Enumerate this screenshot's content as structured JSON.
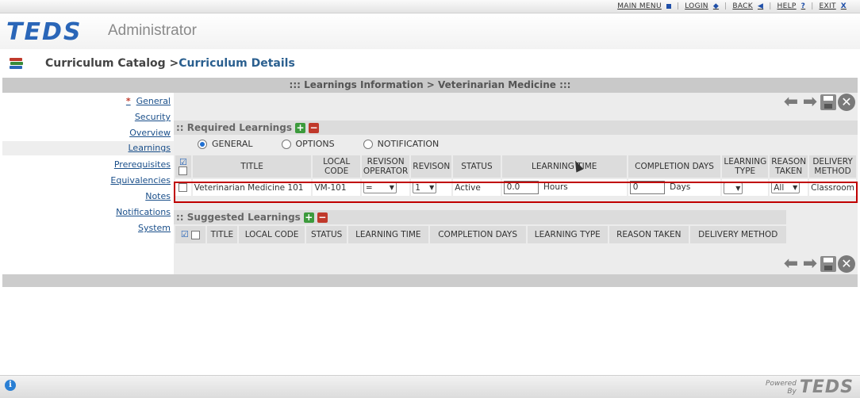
{
  "topnav": {
    "main_menu": "MAIN MENU",
    "login": "LOGIN",
    "back": "BACK",
    "help": "HELP",
    "exit": "EXIT",
    "sep": "|"
  },
  "header": {
    "logo": "TEDS",
    "subtitle": "Administrator"
  },
  "breadcrumb": {
    "parent": "Curriculum Catalog >",
    "current": "Curriculum Details"
  },
  "title_bar": "::: Learnings Information > Veterinarian Medicine :::",
  "sidebar": {
    "required_star": "*",
    "items": [
      {
        "label": "General"
      },
      {
        "label": "Security"
      },
      {
        "label": "Overview"
      },
      {
        "label": "Learnings"
      },
      {
        "label": "Prerequisites"
      },
      {
        "label": "Equivalencies"
      },
      {
        "label": "Notes"
      },
      {
        "label": "Notifications"
      },
      {
        "label": "System"
      }
    ]
  },
  "required": {
    "heading": ":: Required Learnings",
    "radio_options": [
      "GENERAL",
      "OPTIONS",
      "NOTIFICATION"
    ],
    "selected_radio": "GENERAL",
    "columns": [
      "TITLE",
      "LOCAL CODE",
      "REVISON OPERATOR",
      "REVISON",
      "STATUS",
      "LEARNING TIME",
      "COMPLETION DAYS",
      "LEARNING TYPE",
      "REASON TAKEN",
      "DELIVERY METHOD"
    ],
    "row": {
      "title": "Veterinarian Medicine 101",
      "local_code": "VM-101",
      "revision_operator": "=",
      "revision": "1",
      "status": "Active",
      "learning_time": "0.0",
      "learning_time_unit": "Hours",
      "completion_days": "0",
      "completion_unit": "Days",
      "learning_type": "",
      "reason_taken": "All",
      "delivery_method": "Classroom"
    }
  },
  "suggested": {
    "heading": ":: Suggested Learnings",
    "columns": [
      "TITLE",
      "LOCAL CODE",
      "STATUS",
      "LEARNING TIME",
      "COMPLETION DAYS",
      "LEARNING TYPE",
      "REASON TAKEN",
      "DELIVERY METHOD"
    ]
  },
  "footer": {
    "info_icon": "i",
    "powered_by": "Powered By",
    "powered_logo": "TEDS"
  },
  "colors": {
    "brand_blue": "#2a66b8",
    "highlight_red": "#c00000",
    "link": "#1a4f8a"
  }
}
